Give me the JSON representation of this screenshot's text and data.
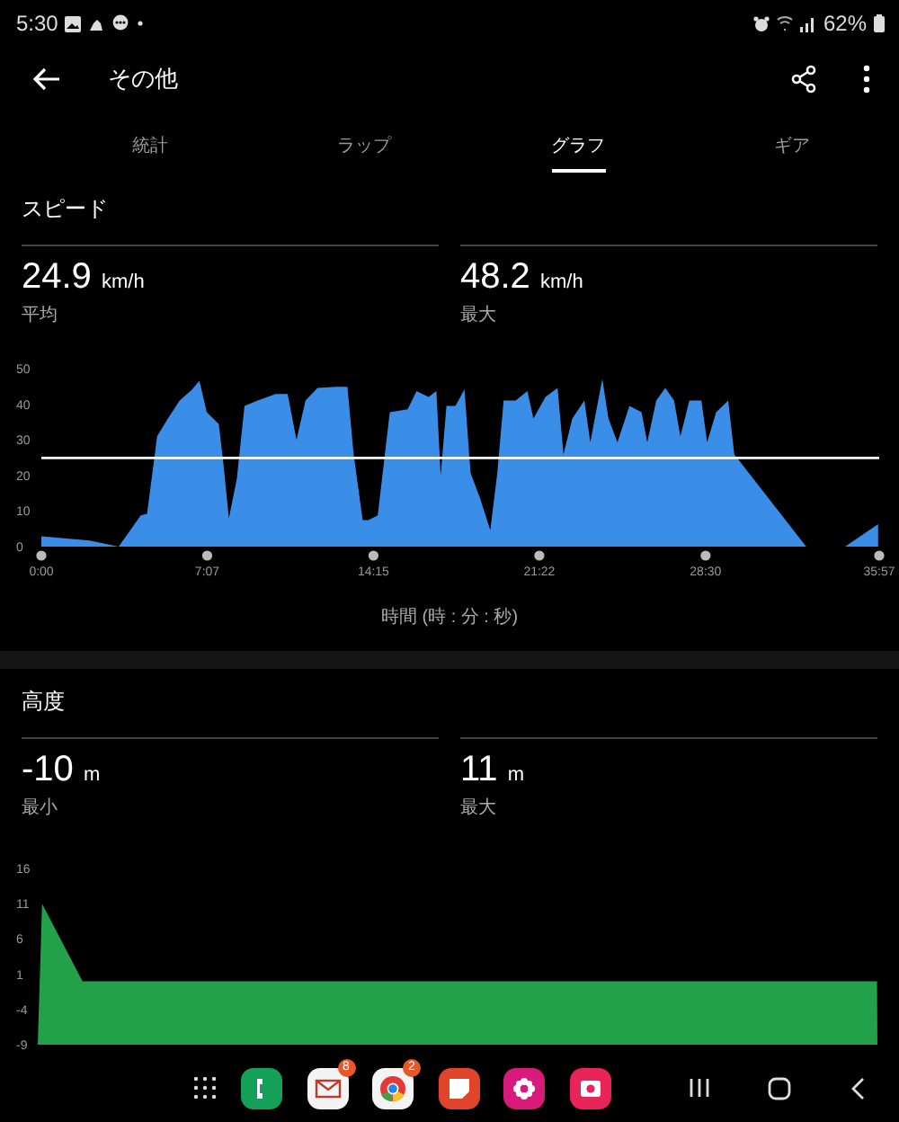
{
  "status_bar": {
    "time": "5:30",
    "battery": "62%"
  },
  "header": {
    "title": "その他"
  },
  "tabs": [
    {
      "label": "統計",
      "selected": false
    },
    {
      "label": "ラップ",
      "selected": false
    },
    {
      "label": "グラフ",
      "selected": true
    },
    {
      "label": "ギア",
      "selected": false
    }
  ],
  "sections": [
    {
      "title": "スピード",
      "stats": [
        {
          "value": "24.9",
          "unit": "km/h",
          "label": "平均"
        },
        {
          "value": "48.2",
          "unit": "km/h",
          "label": "最大"
        }
      ],
      "chart_data": {
        "type": "area",
        "xlabel": "時間 (時 : 分 : 秒)",
        "xlim": [
          0,
          2157
        ],
        "ylim": [
          0,
          50
        ],
        "xticks": [
          {
            "value": 0,
            "label": "0:00"
          },
          {
            "value": 427,
            "label": "7:07"
          },
          {
            "value": 855,
            "label": "14:15"
          },
          {
            "value": 1282,
            "label": "21:22"
          },
          {
            "value": 1710,
            "label": "28:30"
          },
          {
            "value": 2157,
            "label": "35:57"
          }
        ],
        "yticks": [
          0,
          10,
          20,
          30,
          40,
          50
        ],
        "x": [
          0,
          125,
          199,
          256,
          272,
          298,
          326,
          356,
          387,
          407,
          426,
          457,
          468,
          483,
          503,
          523,
          557,
          603,
          634,
          657,
          680,
          711,
          758,
          788,
          804,
          827,
          842,
          866,
          897,
          943,
          966,
          997,
          1017,
          1028,
          1043,
          1066,
          1089,
          1105,
          1128,
          1156,
          1174,
          1190,
          1221,
          1251,
          1267,
          1298,
          1329,
          1344,
          1367,
          1398,
          1413,
          1444,
          1460,
          1483,
          1514,
          1545,
          1560,
          1583,
          1606,
          1629,
          1645,
          1668,
          1699,
          1714,
          1737,
          1768,
          1784,
          1969,
          2069,
          2154
        ],
        "series": [
          {
            "color": "#3a8ee8",
            "values": [
              2.9,
              1.7,
              0,
              8.8,
              9.2,
              31,
              36,
              41,
              44,
              46.6,
              37.8,
              34.4,
              24,
              8,
              19,
              39.5,
              41,
              42.9,
              42.9,
              30,
              41,
              44.6,
              44.9,
              44.9,
              25.9,
              7.5,
              7.5,
              8.8,
              37.8,
              38.6,
              43.7,
              42,
              43.7,
              19.9,
              39.5,
              39.5,
              44.2,
              20.7,
              14,
              4.6,
              20.7,
              41,
              41,
              43.7,
              36,
              42,
              44.6,
              25.9,
              36,
              41,
              29.3,
              47.1,
              36,
              29.3,
              39.5,
              37.8,
              29.3,
              41,
              44.6,
              41,
              31,
              41,
              41,
              29.3,
              37.8,
              41,
              25.9,
              0,
              0,
              6.3
            ]
          }
        ],
        "ref_lines": [
          {
            "axis": "y",
            "value": 24.9
          }
        ]
      }
    },
    {
      "title": "高度",
      "stats": [
        {
          "value": "-10",
          "unit": "m",
          "label": "最小"
        },
        {
          "value": "11",
          "unit": "m",
          "label": "最大"
        }
      ],
      "chart_data": {
        "type": "area",
        "xlim": [
          0,
          2157
        ],
        "ylim": [
          -9,
          16
        ],
        "yticks": [
          -9,
          -4,
          1,
          6,
          11,
          16
        ],
        "x": [
          0,
          11,
          115,
          2156,
          2157
        ],
        "series": [
          {
            "color": "#22a04a",
            "values": [
              -9,
              11,
              0,
              0,
              -9
            ]
          }
        ]
      }
    }
  ],
  "dock": [
    {
      "kind": "phone"
    },
    {
      "kind": "mail",
      "badge": "8"
    },
    {
      "kind": "browser",
      "badge": "2"
    },
    {
      "kind": "notes"
    },
    {
      "kind": "flower"
    },
    {
      "kind": "camera"
    }
  ]
}
